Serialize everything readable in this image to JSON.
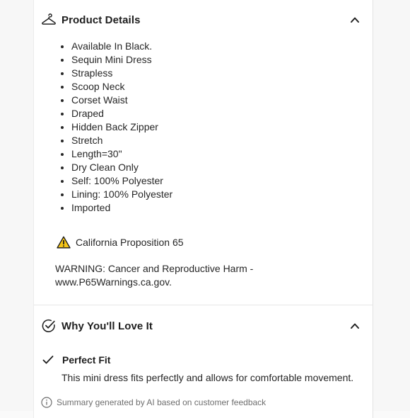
{
  "details_section": {
    "title": "Product Details",
    "icon": "hanger-icon",
    "expanded": true,
    "bullets": [
      "Available In Black.",
      "Sequin Mini Dress",
      "Strapless",
      "Scoop Neck",
      "Corset Waist",
      "Draped",
      "Hidden Back Zipper",
      "Stretch",
      "Length=30\"",
      "Dry Clean Only",
      "Self: 100% Polyester",
      "Lining: 100% Polyester",
      "Imported"
    ],
    "prop65_label": "California Proposition 65",
    "warning_text": "WARNING: Cancer and Reproductive Harm - www.P65Warnings.ca.gov."
  },
  "love_section": {
    "title": "Why You'll Love It",
    "icon": "check-circle-icon",
    "expanded": true,
    "feature_title": "Perfect Fit",
    "feature_description": "This mini dress fits perfectly and allows for comfortable movement.",
    "ai_note": "Summary generated by AI based on customer feedback"
  },
  "colors": {
    "warning_yellow": "#F5C518",
    "text": "#262626",
    "muted": "#6e6e6e"
  }
}
